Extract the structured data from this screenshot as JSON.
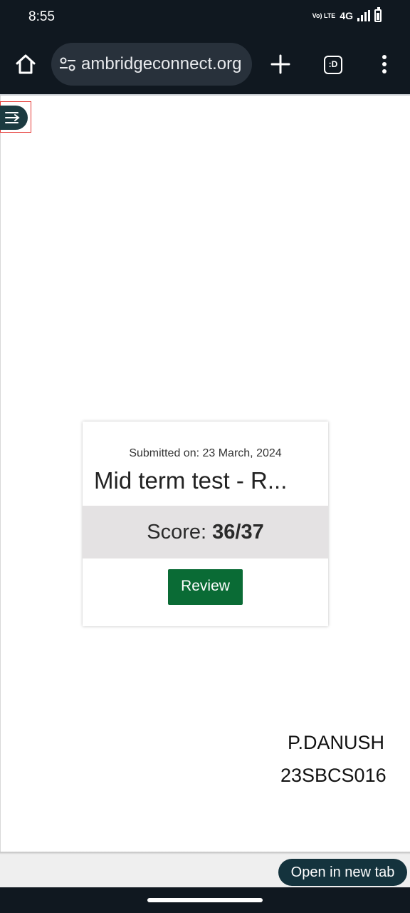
{
  "status_bar": {
    "time": "8:55",
    "volte_label": "Vo) LTE",
    "network": "4G",
    "icons": [
      "volte-icon",
      "signal-icon",
      "battery-icon"
    ]
  },
  "browser": {
    "url": "ambridgeconnect.org",
    "tab_count": ":D",
    "icons": [
      "home-icon",
      "site-settings-icon",
      "plus-icon",
      "tabs-icon",
      "more-vert-icon"
    ]
  },
  "page": {
    "sidebar_toggle_icon": "menu-arrow-icon",
    "card": {
      "submitted": "Submitted on: 23 March, 2024",
      "title": "Mid term test - R...",
      "score_label": "Score: ",
      "score_value": "36/37",
      "review_label": "Review"
    },
    "student_name": "P.DANUSH",
    "student_id": "23SBCS016"
  },
  "bottom_bar": {
    "open_in_new_tab": "Open in new tab"
  },
  "colors": {
    "chrome_dark": "#101820",
    "review_green": "#0a6b35",
    "toggle_teal": "#1b3a40",
    "score_band": "#e4e2e3"
  }
}
